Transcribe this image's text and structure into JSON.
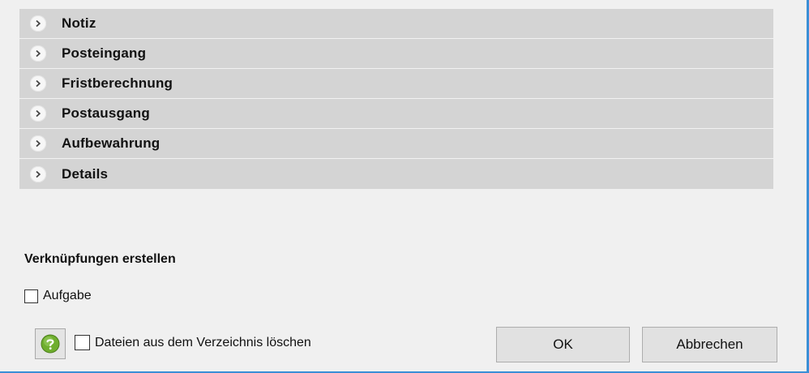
{
  "accordion": {
    "sections": [
      {
        "label": "Notiz"
      },
      {
        "label": "Posteingang"
      },
      {
        "label": "Fristberechnung"
      },
      {
        "label": "Postausgang"
      },
      {
        "label": "Aufbewahrung"
      },
      {
        "label": "Details"
      }
    ]
  },
  "links": {
    "title": "Verknüpfungen erstellen",
    "task_label": "Aufgabe",
    "task_checked": false
  },
  "footer": {
    "delete_files_label": "Dateien aus dem Verzeichnis löschen",
    "delete_files_checked": false,
    "help_icon": "help-icon",
    "ok_label": "OK",
    "cancel_label": "Abbrechen"
  },
  "colors": {
    "section_bg": "#d4d4d4",
    "window_bg": "#f0f0f0",
    "frame_accent": "#3b8fd6",
    "help_green": "#6fae2e"
  }
}
